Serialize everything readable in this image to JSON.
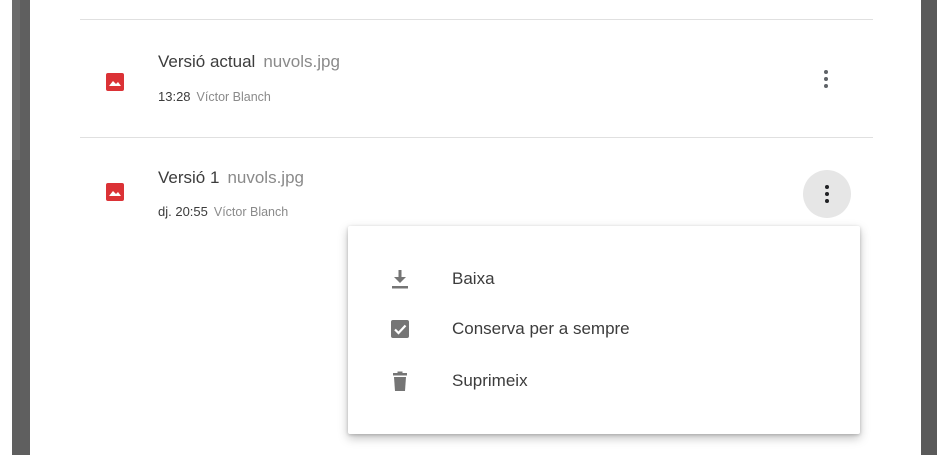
{
  "versions": [
    {
      "label": "Versió actual",
      "filename": "nuvols.jpg",
      "time": "13:28",
      "author": "Víctor Blanch",
      "icon": "image-file-icon",
      "menu_open": false
    },
    {
      "label": "Versió 1",
      "filename": "nuvols.jpg",
      "time": "dj. 20:55",
      "author": "Víctor Blanch",
      "icon": "image-file-icon",
      "menu_open": true
    }
  ],
  "context_menu": {
    "items": [
      {
        "label": "Baixa",
        "icon": "download-icon"
      },
      {
        "label": "Conserva per a sempre",
        "icon": "checkbox-checked-icon"
      },
      {
        "label": "Suprimeix",
        "icon": "trash-icon"
      }
    ]
  },
  "colors": {
    "file_icon_red": "#db3236",
    "text_primary": "#3c3c3c",
    "text_secondary": "#8a8a8a",
    "active_button_bg": "#e6e6e6",
    "menu_icon_gray": "#757575"
  }
}
